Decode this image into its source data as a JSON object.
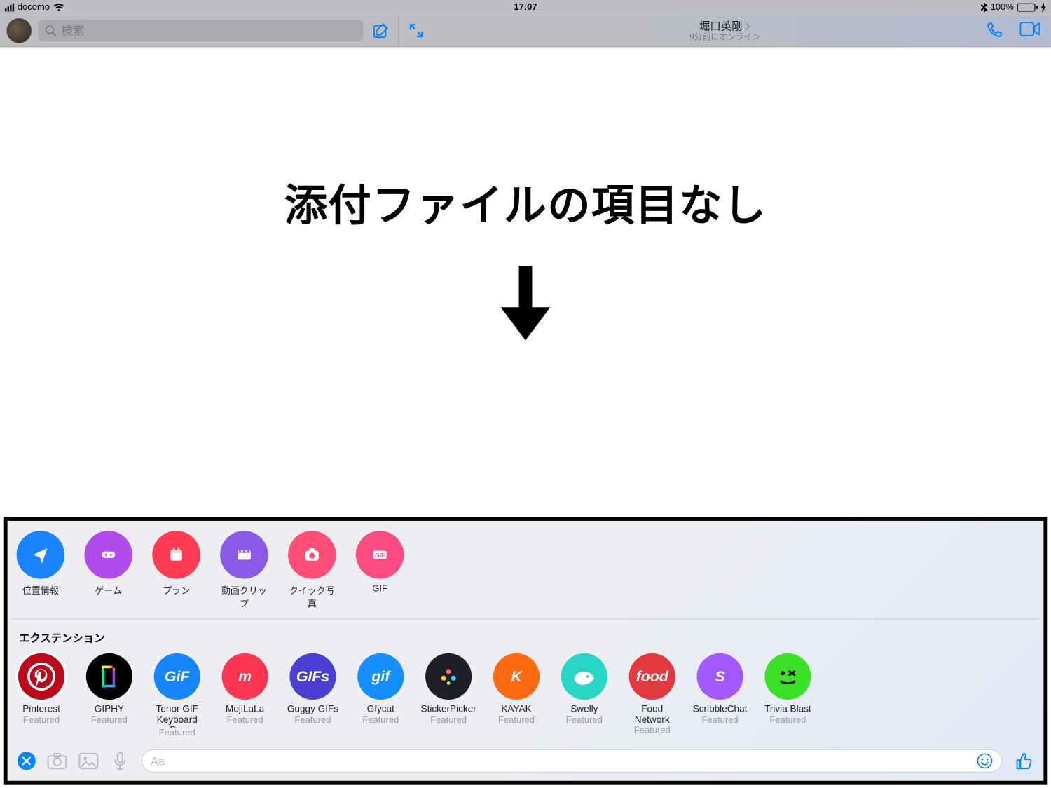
{
  "status": {
    "carrier": "docomo",
    "time": "17:07",
    "battery_pct": "100%"
  },
  "header": {
    "search_placeholder": "検索",
    "contact_name": "堀口英剛",
    "contact_status": "9分前にオンライン"
  },
  "annotation": {
    "text": "添付ファイルの項目なし"
  },
  "quick_actions": [
    {
      "label": "位置情報",
      "color": "#1a84ff"
    },
    {
      "label": "ゲーム",
      "color": "#b24bec"
    },
    {
      "label": "プラン",
      "color": "#ff3b54"
    },
    {
      "label": "動画クリップ",
      "color": "#8a59e8"
    },
    {
      "label": "クイック写真",
      "color": "#ff4f79"
    },
    {
      "label": "GIF",
      "color": "#fc4c84"
    }
  ],
  "extensions_label": "エクステンション",
  "featured_label": "Featured",
  "extensions": [
    {
      "name": "Pinterest",
      "color": "#bd081c",
      "text": "",
      "icon": "pinterest"
    },
    {
      "name": "GIPHY",
      "color": "#000000",
      "text": "",
      "icon": "giphy"
    },
    {
      "name": "Tenor GIF Keyboard B...",
      "color": "#1584ff",
      "text": "GiF",
      "icon": ""
    },
    {
      "name": "MojiLaLa",
      "color": "#ff3554",
      "text": "m",
      "icon": ""
    },
    {
      "name": "Guggy GIFs",
      "color": "#4b3fd4",
      "text": "GIFs",
      "icon": ""
    },
    {
      "name": "Gfycat",
      "color": "#158fff",
      "text": "gif",
      "icon": ""
    },
    {
      "name": "StickerPicker",
      "color": "#1e1e28",
      "text": "",
      "icon": "sticker"
    },
    {
      "name": "KAYAK",
      "color": "#ff690f",
      "text": "K",
      "icon": ""
    },
    {
      "name": "Swelly",
      "color": "#28d6c5",
      "text": "",
      "icon": "whale"
    },
    {
      "name": "Food Network",
      "color": "#e2383e",
      "text": "food",
      "icon": ""
    },
    {
      "name": "ScribbleChat",
      "color": "#a259ff",
      "text": "S",
      "icon": ""
    },
    {
      "name": "Trivia Blast",
      "color": "#3be127",
      "text": "",
      "icon": "wink"
    }
  ],
  "input": {
    "placeholder": "Aa"
  }
}
